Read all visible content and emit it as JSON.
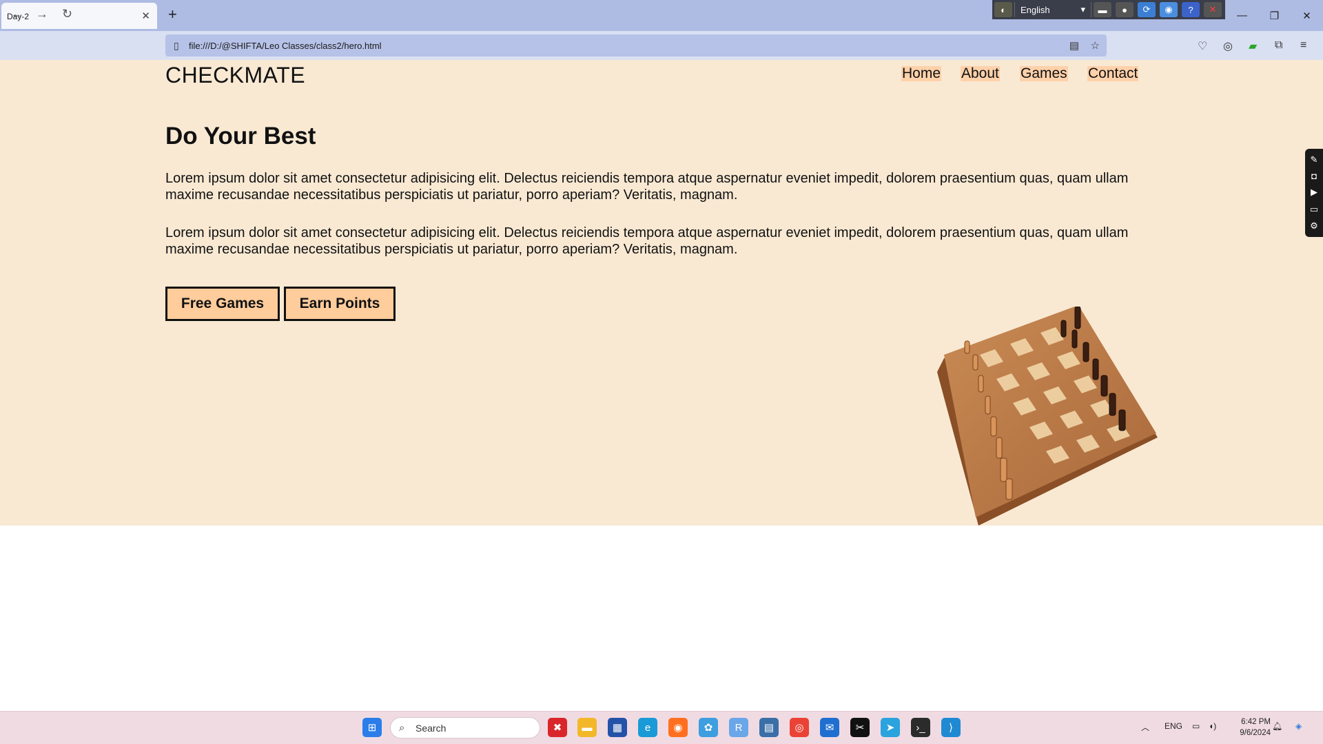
{
  "browser": {
    "tab_title": "Day-2",
    "tab_close": "✕",
    "new_tab": "+",
    "url": "file:///D:/@SHIFTA/Leo Classes/class2/hero.html",
    "extension_language": "English"
  },
  "page": {
    "brand": "CHECKMATE",
    "nav": [
      {
        "label": "Home"
      },
      {
        "label": "About"
      },
      {
        "label": "Games"
      },
      {
        "label": "Contact"
      }
    ],
    "headline": "Do Your Best",
    "paragraphs": [
      "Lorem ipsum dolor sit amet consectetur adipisicing elit. Delectus reiciendis tempora atque aspernatur eveniet impedit, dolorem praesentium quas, quam ullam maxime recusandae necessitatibus perspiciatis ut pariatur, porro aperiam? Veritatis, magnam.",
      "Lorem ipsum dolor sit amet consectetur adipisicing elit. Delectus reiciendis tempora atque aspernatur eveniet impedit, dolorem praesentium quas, quam ullam maxime recusandae necessitatibus perspiciatis ut pariatur, porro aperiam? Veritatis, magnam."
    ],
    "buttons": [
      {
        "label": "Free Games"
      },
      {
        "label": "Earn Points"
      }
    ],
    "colors": {
      "hero_bg": "#f9e9d3",
      "button_bg": "#ffcc9c",
      "nav_highlight": "#ffd1aa"
    }
  },
  "taskbar": {
    "search_placeholder": "Search",
    "language": "ENG",
    "time": "6:42 PM",
    "date": "9/6/2024"
  }
}
